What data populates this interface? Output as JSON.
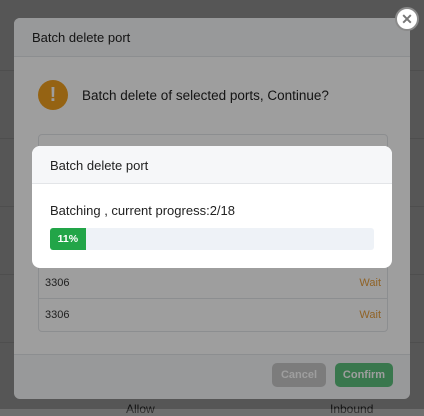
{
  "background": {
    "footer_left": "Allow",
    "footer_right": "Inbound"
  },
  "outer_dialog": {
    "title": "Batch delete port",
    "message": "Batch delete of selected ports, Continue?",
    "rows": [
      {
        "port": "3306",
        "status": "Wait"
      },
      {
        "port": "3306",
        "status": "Wait"
      }
    ],
    "cancel_label": "Cancel",
    "confirm_label": "Confirm",
    "close_glyph": "✕",
    "warning_glyph": "!"
  },
  "progress_dialog": {
    "title": "Batch delete port",
    "status_text": "Batching , current progress:2/18",
    "percent_label": "11%",
    "progress_fraction": 0.11
  },
  "colors": {
    "warning": "#f0a020",
    "progress": "#22a548",
    "confirm": "#5cc07d",
    "wait_status": "#e8a040"
  }
}
